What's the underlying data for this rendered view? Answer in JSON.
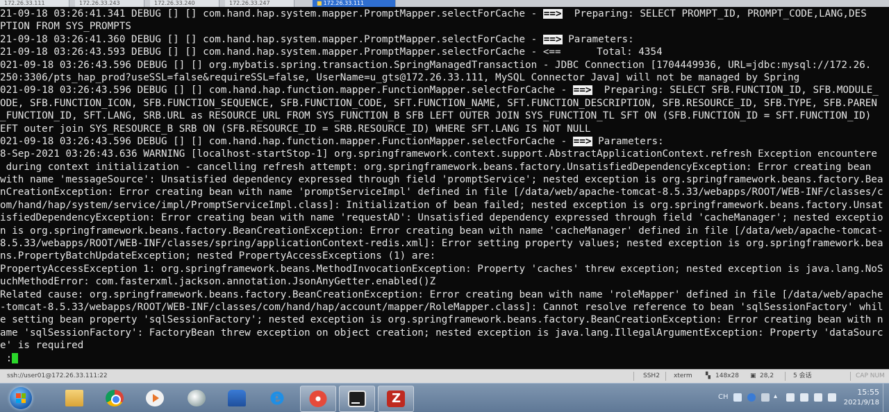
{
  "tabs": [
    {
      "label": "172.26.33.111"
    },
    {
      "label": "172.26.33.243"
    },
    {
      "label": "172.26.33.240"
    },
    {
      "label": "172.26.33.247"
    },
    {
      "label": "172.26.33.111"
    }
  ],
  "terminal": {
    "lines": [
      "21-09-18 03:26:41.341 DEBUG [] [] com.hand.hap.system.mapper.PromptMapper.selectForCache - |==>|  Preparing: SELECT PROMPT_ID, PROMPT_CODE,LANG,DES",
      "PTION FROM SYS_PROMPTS",
      "21-09-18 03:26:41.360 DEBUG [] [] com.hand.hap.system.mapper.PromptMapper.selectForCache - |==>| Parameters:",
      "21-09-18 03:26:43.593 DEBUG [] [] com.hand.hap.system.mapper.PromptMapper.selectForCache - <==      Total: 4354",
      "021-09-18 03:26:43.596 DEBUG [] [] org.mybatis.spring.transaction.SpringManagedTransaction - JDBC Connection [1704449936, URL=jdbc:mysql://172.26.",
      "250:3306/pts_hap_prod?useSSL=false&requireSSL=false, UserName=u_gts@172.26.33.111, MySQL Connector Java] will not be managed by Spring",
      "021-09-18 03:26:43.596 DEBUG [] [] com.hand.hap.function.mapper.FunctionMapper.selectForCache - |==>|  Preparing: SELECT SFB.FUNCTION_ID, SFB.MODULE_",
      "ODE, SFB.FUNCTION_ICON, SFB.FUNCTION_SEQUENCE, SFB.FUNCTION_CODE, SFT.FUNCTION_NAME, SFT.FUNCTION_DESCRIPTION, SFB.RESOURCE_ID, SFB.TYPE, SFB.PAREN",
      "_FUNCTION_ID, SFT.LANG, SRB.URL as RESOURCE_URL FROM SYS_FUNCTION_B SFB LEFT OUTER JOIN SYS_FUNCTION_TL SFT ON (SFB.FUNCTION_ID = SFT.FUNCTION_ID)",
      "EFT outer join SYS_RESOURCE_B SRB ON (SFB.RESOURCE_ID = SRB.RESOURCE_ID) WHERE SFT.LANG IS NOT NULL",
      "021-09-18 03:26:43.596 DEBUG [] [] com.hand.hap.function.mapper.FunctionMapper.selectForCache - |==>| Parameters:",
      "8-Sep-2021 03:26:43.636 WARNING [localhost-startStop-1] org.springframework.context.support.AbstractApplicationContext.refresh Exception encountere",
      " during context initialization - cancelling refresh attempt: org.springframework.beans.factory.UnsatisfiedDependencyException: Error creating bean",
      "with name 'messageSource': Unsatisfied dependency expressed through field 'promptService'; nested exception is org.springframework.beans.factory.Bea",
      "nCreationException: Error creating bean with name 'promptServiceImpl' defined in file [/data/web/apache-tomcat-8.5.33/webapps/ROOT/WEB-INF/classes/c",
      "om/hand/hap/system/service/impl/PromptServiceImpl.class]: Initialization of bean failed; nested exception is org.springframework.beans.factory.Unsat",
      "isfiedDependencyException: Error creating bean with name 'requestAD': Unsatisfied dependency expressed through field 'cacheManager'; nested exceptio",
      "n is org.springframework.beans.factory.BeanCreationException: Error creating bean with name 'cacheManager' defined in file [/data/web/apache-tomcat-",
      "8.5.33/webapps/ROOT/WEB-INF/classes/spring/applicationContext-redis.xml]: Error setting property values; nested exception is org.springframework.bea",
      "ns.PropertyBatchUpdateException; nested PropertyAccessExceptions (1) are:",
      "PropertyAccessException 1: org.springframework.beans.MethodInvocationException: Property 'caches' threw exception; nested exception is java.lang.NoS",
      "uchMethodError: com.fasterxml.jackson.annotation.JsonAnyGetter.enabled()Z",
      "Related cause: org.springframework.beans.factory.BeanCreationException: Error creating bean with name 'roleMapper' defined in file [/data/web/apache",
      "-tomcat-8.5.33/webapps/ROOT/WEB-INF/classes/com/hand/hap/account/mapper/RoleMapper.class]: Cannot resolve reference to bean 'sqlSessionFactory' whil",
      "e setting bean property 'sqlSessionFactory'; nested exception is org.springframework.beans.factory.BeanCreationException: Error creating bean with n",
      "ame 'sqlSessionFactory': FactoryBean threw exception on object creation; nested exception is java.lang.IllegalArgumentException: Property 'dataSourc",
      "e' is required"
    ],
    "prompt": ":"
  },
  "statusbar": {
    "connection": "ssh://user01@172.26.33.111:22",
    "protocol": "SSH2",
    "terminal_type": "xterm",
    "size": "148x28",
    "cursor_pos": "28,2",
    "sessions": "5 会话",
    "caps": "CAP NUM"
  },
  "taskbar": {
    "apps": [
      {
        "icon": "folder-icon"
      },
      {
        "icon": "chrome-icon"
      },
      {
        "icon": "media-player-icon"
      },
      {
        "icon": "soccer-ball-icon"
      },
      {
        "icon": "user-app-icon"
      },
      {
        "icon": "internet-explorer-icon"
      },
      {
        "icon": "snail-icon"
      },
      {
        "icon": "intellij-idea-icon"
      },
      {
        "icon": "filezilla-icon"
      }
    ],
    "tray": {
      "ime": "CH",
      "time": "15:55",
      "date": "2021/9/18"
    }
  },
  "colors": {
    "terminal_bg": "#0a0a0a",
    "terminal_fg": "#e6e6e6",
    "cursor": "#2ad62a",
    "tab_active": "#2f6fd1"
  }
}
